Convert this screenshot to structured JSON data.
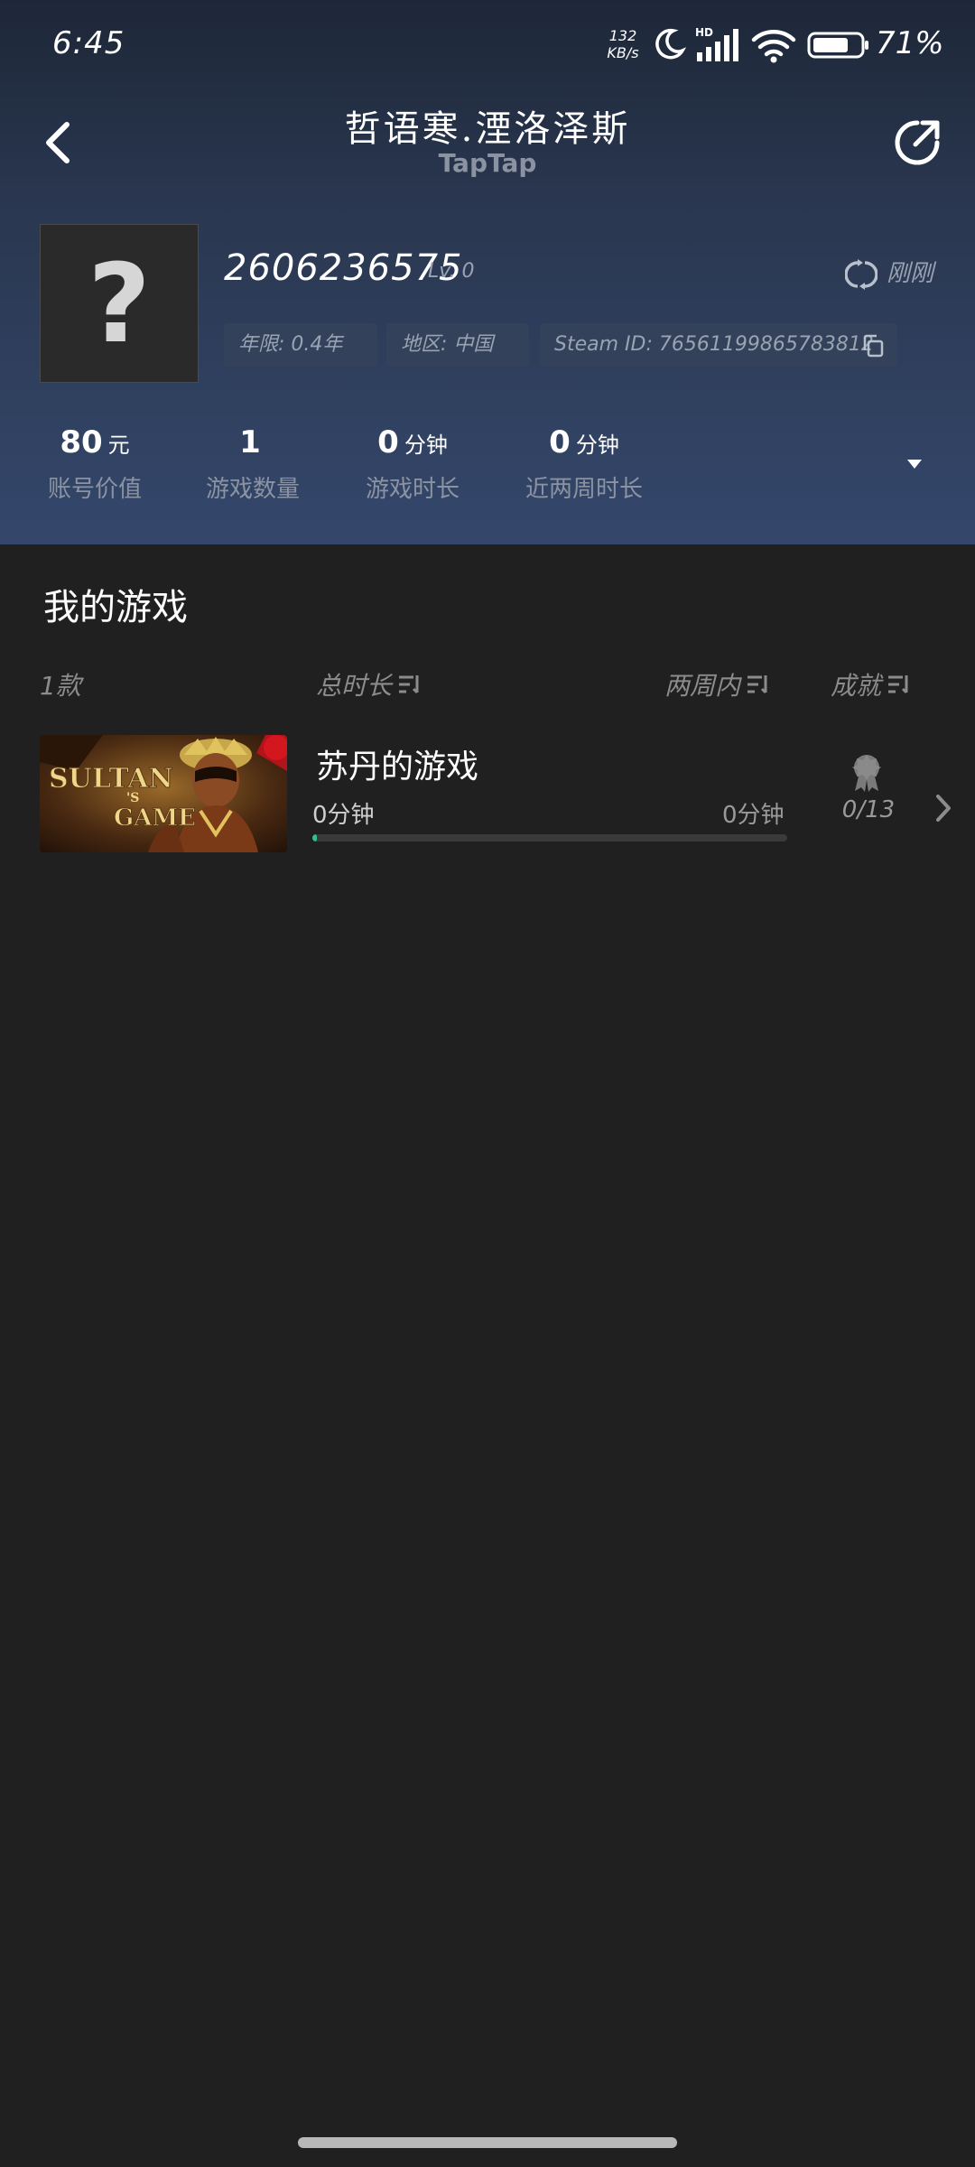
{
  "status_bar": {
    "time": "6:45",
    "net_speed_value": "132",
    "net_speed_unit": "KB/s",
    "battery": "71%"
  },
  "header": {
    "title": "哲语寒.湮洛泽斯",
    "subtitle": "TapTap"
  },
  "profile": {
    "avatar_glyph": "?",
    "account_id": "2606236575",
    "level": "Lv. 0",
    "refresh_text": "刚刚",
    "chips": {
      "age": "年限: 0.4年",
      "region": "地区: 中国",
      "steam_id": "Steam ID: 76561199865783812"
    }
  },
  "stats": [
    {
      "value": "80",
      "unit": "元",
      "label": "账号价值"
    },
    {
      "value": "1",
      "unit": "",
      "label": "游戏数量"
    },
    {
      "value": "0",
      "unit": "分钟",
      "label": "游戏时长"
    },
    {
      "value": "0",
      "unit": "分钟",
      "label": "近两周时长"
    }
  ],
  "games_section": {
    "title": "我的游戏",
    "columns": {
      "count": "1款",
      "total": "总时长",
      "recent": "两周内",
      "achievements": "成就"
    },
    "games": [
      {
        "name": "苏丹的游戏",
        "total_time": "0分钟",
        "recent_time": "0分钟",
        "achievements": "0/13",
        "progress": 0.01,
        "cover_text": "SULTAN'S GAME"
      }
    ]
  },
  "colors": {
    "accent_green": "#2ec291",
    "page_bg": "#202020",
    "header_top": "#1d2738",
    "header_bottom": "#34476b"
  }
}
